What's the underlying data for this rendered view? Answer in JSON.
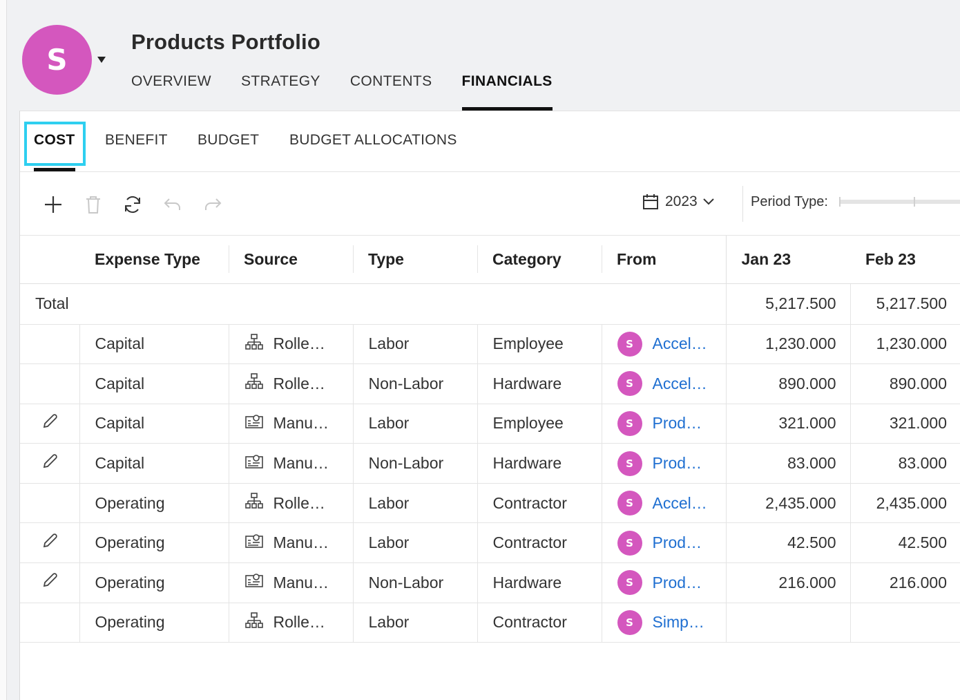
{
  "header": {
    "avatar_letter": "S",
    "title": "Products Portfolio",
    "tabs": [
      {
        "label": "OVERVIEW",
        "active": false
      },
      {
        "label": "STRATEGY",
        "active": false
      },
      {
        "label": "CONTENTS",
        "active": false
      },
      {
        "label": "FINANCIALS",
        "active": true
      }
    ]
  },
  "sub_tabs": [
    {
      "label": "COST",
      "active": true
    },
    {
      "label": "BENEFIT",
      "active": false
    },
    {
      "label": "BUDGET",
      "active": false
    },
    {
      "label": "BUDGET ALLOCATIONS",
      "active": false
    }
  ],
  "toolbar": {
    "year": "2023",
    "period_label": "Period Type:",
    "icons": [
      "add-icon",
      "delete-icon",
      "refresh-icon",
      "undo-icon",
      "redo-icon",
      "calendar-icon",
      "chevron-down-icon"
    ]
  },
  "table": {
    "columns": [
      "",
      "Expense Type",
      "Source",
      "Type",
      "Category",
      "From",
      "Jan 23",
      "Feb 23"
    ],
    "total_row": {
      "label": "Total",
      "jan": "5,217.500",
      "feb": "5,217.500"
    },
    "rows": [
      {
        "editable": false,
        "expense_type": "Capital",
        "source_icon": "rollup-icon",
        "source": "Rolle…",
        "type": "Labor",
        "category": "Employee",
        "from_letter": "S",
        "from": "Accel…",
        "jan": "1,230.000",
        "feb": "1,230.000"
      },
      {
        "editable": false,
        "expense_type": "Capital",
        "source_icon": "rollup-icon",
        "source": "Rolle…",
        "type": "Non-Labor",
        "category": "Hardware",
        "from_letter": "S",
        "from": "Accel…",
        "jan": "890.000",
        "feb": "890.000"
      },
      {
        "editable": true,
        "expense_type": "Capital",
        "source_icon": "manual-entry-icon",
        "source": "Manu…",
        "type": "Labor",
        "category": "Employee",
        "from_letter": "S",
        "from": "Prod…",
        "jan": "321.000",
        "feb": "321.000"
      },
      {
        "editable": true,
        "expense_type": "Capital",
        "source_icon": "manual-entry-icon",
        "source": "Manu…",
        "type": "Non-Labor",
        "category": "Hardware",
        "from_letter": "S",
        "from": "Prod…",
        "jan": "83.000",
        "feb": "83.000"
      },
      {
        "editable": false,
        "expense_type": "Operating",
        "source_icon": "rollup-icon",
        "source": "Rolle…",
        "type": "Labor",
        "category": "Contractor",
        "from_letter": "S",
        "from": "Accel…",
        "jan": "2,435.000",
        "feb": "2,435.000"
      },
      {
        "editable": true,
        "expense_type": "Operating",
        "source_icon": "manual-entry-icon",
        "source": "Manu…",
        "type": "Labor",
        "category": "Contractor",
        "from_letter": "S",
        "from": "Prod…",
        "jan": "42.500",
        "feb": "42.500"
      },
      {
        "editable": true,
        "expense_type": "Operating",
        "source_icon": "manual-entry-icon",
        "source": "Manu…",
        "type": "Non-Labor",
        "category": "Hardware",
        "from_letter": "S",
        "from": "Prod…",
        "jan": "216.000",
        "feb": "216.000"
      },
      {
        "editable": false,
        "expense_type": "Operating",
        "source_icon": "rollup-icon",
        "source": "Rolle…",
        "type": "Labor",
        "category": "Contractor",
        "from_letter": "S",
        "from": "Simp…",
        "jan": "",
        "feb": ""
      }
    ]
  },
  "colors": {
    "avatar": "#d457be",
    "link": "#1f6fd1",
    "highlight": "#2ecff0"
  }
}
